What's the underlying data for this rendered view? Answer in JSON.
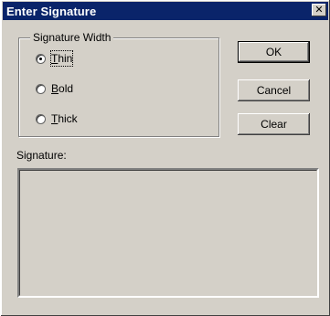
{
  "dialog": {
    "title": "Enter Signature",
    "close_glyph": "✕"
  },
  "width_group": {
    "legend": "Signature Width",
    "options": [
      {
        "prefix": "",
        "accel": "T",
        "rest": "hin",
        "checked": true
      },
      {
        "prefix": "",
        "accel": "B",
        "rest": "old",
        "checked": false
      },
      {
        "prefix": "",
        "accel": "T",
        "rest": "hick",
        "checked": false
      }
    ]
  },
  "buttons": {
    "ok": "OK",
    "cancel": "Cancel",
    "clear": "Clear"
  },
  "signature": {
    "label": "Signature:"
  },
  "icons": {
    "close": "close-icon"
  }
}
